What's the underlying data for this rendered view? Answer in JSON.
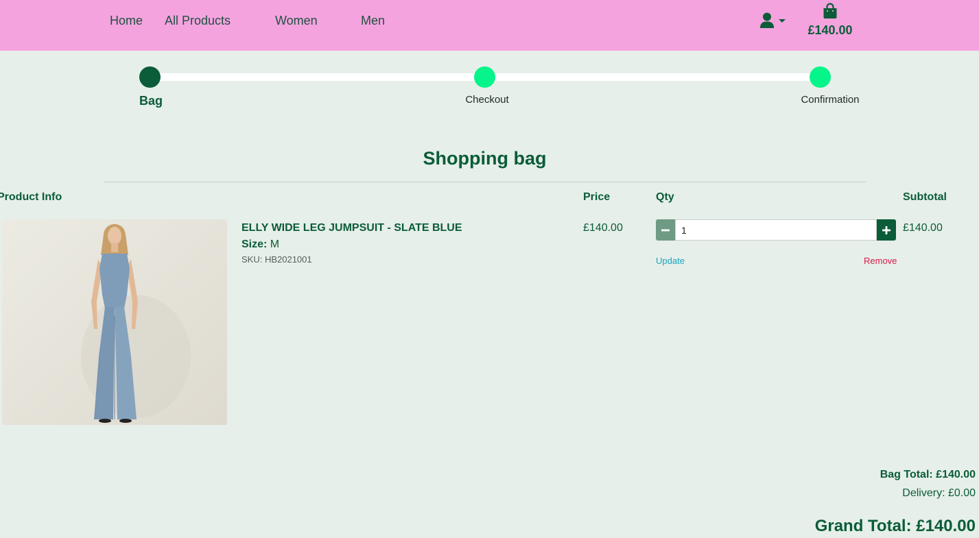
{
  "nav": {
    "links": [
      "Home",
      "All Products",
      "Women",
      "Men"
    ],
    "bag_total": "£140.00"
  },
  "icons": {
    "user": "user-icon",
    "caret": "caret-down-icon",
    "bag": "shopping-bag-icon"
  },
  "progress": {
    "steps": [
      {
        "label": "Bag",
        "state": "active"
      },
      {
        "label": "Checkout",
        "state": "pending"
      },
      {
        "label": "Confirmation",
        "state": "pending"
      }
    ]
  },
  "page": {
    "title": "Shopping bag"
  },
  "table": {
    "headers": {
      "product_info": "Product Info",
      "price": "Price",
      "qty": "Qty",
      "subtotal": "Subtotal"
    },
    "rows": [
      {
        "name": "ELLY WIDE LEG JUMPSUIT - SLATE BLUE",
        "size_label": "Size:",
        "size_value": "M",
        "sku": "SKU: HB2021001",
        "price": "£140.00",
        "qty": "1",
        "subtotal": "£140.00",
        "update_label": "Update",
        "remove_label": "Remove"
      }
    ]
  },
  "totals": {
    "bag_total": "Bag Total: £140.00",
    "delivery": "Delivery: £0.00",
    "grand_total": "Grand Total: £140.00"
  },
  "colors": {
    "navbar_bg": "#f5a3df",
    "page_bg": "#e6efe9",
    "brand_green": "#0b5c38",
    "step_pending": "#06f58a",
    "update_link": "#1aa3c0",
    "remove_link": "#d8184a"
  }
}
